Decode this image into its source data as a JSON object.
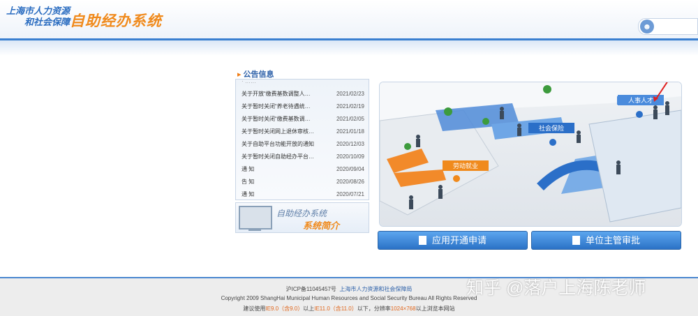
{
  "header": {
    "org_line1": "上海市人力资源",
    "org_line2": "和社会保障",
    "system_title": "自助经办系统"
  },
  "notices": {
    "title": "公告信息",
    "items": [
      {
        "title": "关于开放“缴费基数调整人…",
        "date": "2021/02/23"
      },
      {
        "title": "关于暂时关闭“养老待遇统…",
        "date": "2021/02/19"
      },
      {
        "title": "关于暂时关闭“缴费基数调…",
        "date": "2021/02/05"
      },
      {
        "title": "关于暂时关闭网上退休审核…",
        "date": "2021/01/18"
      },
      {
        "title": "关于自助平台功能开放的通知",
        "date": "2020/12/03"
      },
      {
        "title": "关于暂时关闭自助经办平台…",
        "date": "2020/10/09"
      },
      {
        "title": "通 知",
        "date": "2020/09/04"
      },
      {
        "title": "告 知",
        "date": "2020/08/26"
      },
      {
        "title": "通 知",
        "date": "2020/07/21"
      }
    ]
  },
  "intro": {
    "line1": "自助经办系统",
    "line2": "系统简介"
  },
  "scene": {
    "tag_labor": "劳动就业",
    "tag_social": "社会保险",
    "tag_hr": "人事人才"
  },
  "buttons": {
    "apply": "应用开通申请",
    "review": "单位主管审批"
  },
  "footer": {
    "icp": "沪ICP备11045457号",
    "site_link": "上海市人力资源和社会保障局",
    "copyright": "Copyright 2009 ShangHai Municipal Human Resources and Social Security Bureau All Rights Reserved",
    "browser_prefix": "建议使用",
    "browser_ie": "IE9.0（含9.0）",
    "browser_mid": "以上",
    "browser_ie11": "IE11.0（含11.0）",
    "browser_res_prefix": "以下，分辨率",
    "browser_res": "1024×768",
    "browser_suffix": "以上浏览本网站"
  },
  "watermark": "知乎 @落户上海陈老师"
}
